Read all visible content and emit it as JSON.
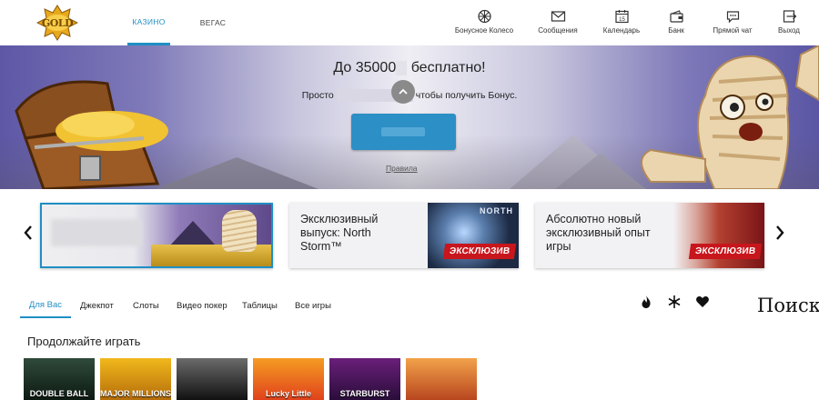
{
  "header": {
    "logo_text": "GOLD",
    "tabs": [
      {
        "label": "КАЗИНО",
        "active": true
      },
      {
        "label": "ВЕГАС",
        "active": false
      }
    ],
    "buttons": [
      {
        "label": "Бонусное Колесо",
        "icon": "wheel-icon"
      },
      {
        "label": "Сообщения",
        "icon": "envelope-icon"
      },
      {
        "label": "Календарь",
        "icon": "calendar-icon",
        "calendar_day": "15"
      },
      {
        "label": "Банк",
        "icon": "wallet-icon"
      },
      {
        "label": "Прямой чат",
        "icon": "chat-icon"
      },
      {
        "label": "Выход",
        "icon": "exit-icon"
      }
    ]
  },
  "hero": {
    "title_prefix": "До 35000",
    "title_suffix": "бесплатно!",
    "subtitle_prefix": "Просто",
    "subtitle_suffix": "чтобы получить Бонус.",
    "rules_link": "Правила",
    "collapse_icon": "chevron-up-icon"
  },
  "promos": [
    {
      "text": "",
      "badge": ""
    },
    {
      "text": "Эксклюзивный выпуск: North Storm™",
      "badge": "ЭКСКЛЮЗИВ",
      "art_label": "NORTH"
    },
    {
      "text": "Абсолютно новый эксклюзивный опыт игры",
      "badge": "ЭКСКЛЮЗИВ"
    }
  ],
  "filters": {
    "tabs": [
      {
        "label": "Для Вас",
        "active": true
      },
      {
        "label": "Джекпот",
        "active": false
      },
      {
        "label": "Слоты",
        "active": false
      },
      {
        "label": "Видео покер",
        "active": false
      },
      {
        "label": "Таблицы",
        "active": false
      },
      {
        "label": "Все игры",
        "active": false
      }
    ],
    "icons": [
      "fire-icon",
      "snowflake-icon",
      "heart-icon"
    ],
    "search_label": "Поиск"
  },
  "continue_section": {
    "title": "Продолжайте играть",
    "games": [
      "DOUBLE BALL",
      "MAJOR MILLIONS",
      "",
      "Lucky Little",
      "STARBURST",
      ""
    ]
  },
  "colors": {
    "accent": "#1f8fc4",
    "exclusive_badge": "#c8161d"
  }
}
